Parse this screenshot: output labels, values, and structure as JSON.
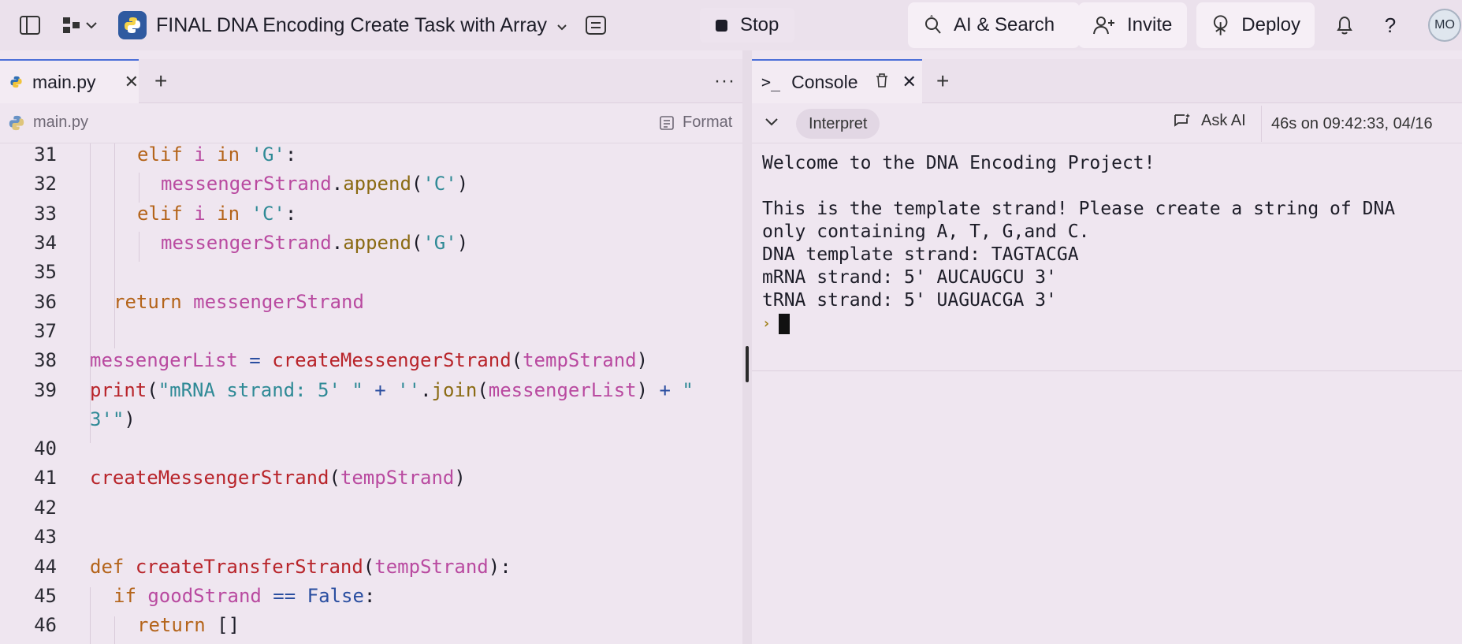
{
  "topbar": {
    "repl_title": "FINAL DNA Encoding Create Task with Array",
    "stop_label": "Stop",
    "ai_search_label": "AI & Search",
    "invite_label": "Invite",
    "deploy_label": "Deploy",
    "help_label": "?",
    "avatar_initials": "MO"
  },
  "editor": {
    "tab_label": "main.py",
    "breadcrumb": "main.py",
    "format_label": "Format",
    "lines": [
      {
        "n": "31"
      },
      {
        "n": "32"
      },
      {
        "n": "33"
      },
      {
        "n": "34"
      },
      {
        "n": "35"
      },
      {
        "n": "36"
      },
      {
        "n": "37"
      },
      {
        "n": "38"
      },
      {
        "n": "39"
      },
      {
        "n": "40"
      },
      {
        "n": "41"
      },
      {
        "n": "42"
      },
      {
        "n": "43"
      },
      {
        "n": "44"
      },
      {
        "n": "45"
      },
      {
        "n": "46"
      }
    ],
    "code": {
      "l31": [
        "elif",
        " i ",
        "in",
        " ",
        "'G'",
        ":"
      ],
      "l32": [
        "messengerStrand",
        ".",
        "append",
        "(",
        "'C'",
        ")"
      ],
      "l33": [
        "elif",
        " i ",
        "in",
        " ",
        "'C'",
        ":"
      ],
      "l34": [
        "messengerStrand",
        ".",
        "append",
        "(",
        "'G'",
        ")"
      ],
      "l36": [
        "return",
        " ",
        "messengerStrand"
      ],
      "l38": [
        "messengerList",
        " = ",
        "createMessengerStrand",
        "(",
        "tempStrand",
        ")"
      ],
      "l39a": [
        "print",
        "(",
        "\"mRNA strand: 5' \"",
        " + ",
        "''",
        ".",
        "join",
        "(",
        "messengerList",
        ")",
        " + ",
        "\""
      ],
      "l39b": [
        "3'\"",
        ")"
      ],
      "l41": [
        "createMessengerStrand",
        "(",
        "tempStrand",
        ")"
      ],
      "l44": [
        "def",
        " ",
        "createTransferStrand",
        "(",
        "tempStrand",
        "):"
      ],
      "l45": [
        "if",
        " ",
        "goodStrand",
        " == ",
        "False",
        ":"
      ],
      "l46": [
        "return",
        " []"
      ]
    }
  },
  "console": {
    "tab_label": "Console",
    "interpret_label": "Interpret",
    "ask_ai_label": "Ask AI",
    "run_info": "46s on 09:42:33, 04/16",
    "output": [
      "Welcome to the DNA Encoding Project!",
      "",
      "This is the template strand! Please create a string of DNA",
      "only containing A, T, G,and C.",
      "DNA template strand: TAGTACGA",
      "mRNA strand: 5' AUCAUGCU 3'",
      "tRNA strand: 5' UAGUACGA 3'"
    ]
  },
  "colors": {
    "background": "#efe6f0",
    "accent_tab": "#4b6fd8",
    "keyword": "#b4641a",
    "function": "#b8242a",
    "variable": "#b94aa0",
    "string": "#2f8a96"
  }
}
